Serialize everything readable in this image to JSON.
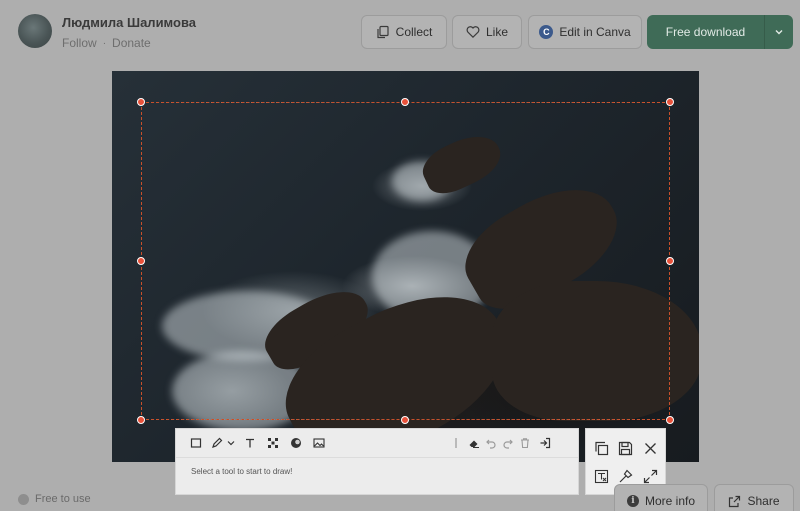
{
  "author": {
    "name": "Людмила Шалимова",
    "follow": "Follow",
    "separator": "·",
    "donate": "Donate"
  },
  "header_actions": {
    "collect": "Collect",
    "like": "Like",
    "edit_canva": "Edit in Canva",
    "canva_mark": "C",
    "download": "Free download"
  },
  "drawing_toolbar": {
    "hint": "Select a tool to start to draw!",
    "tools": [
      "rectangle-icon",
      "pen-icon",
      "chevron-down-icon",
      "text-icon",
      "mosaic-icon",
      "blur-icon",
      "image-icon",
      "eraser-icon",
      "undo-icon",
      "redo-icon",
      "delete-icon",
      "exit-icon"
    ]
  },
  "side_panel": {
    "buttons": [
      "copy-icon",
      "save-icon",
      "close-icon",
      "ocr-icon",
      "pin-icon",
      "fullscreen-icon"
    ]
  },
  "footer": {
    "license": "Free to use",
    "more_info": "More info",
    "info_mark": "i",
    "share": "Share"
  },
  "colors": {
    "accent_green": "#3f6b57",
    "handle_red": "#e8513a"
  }
}
